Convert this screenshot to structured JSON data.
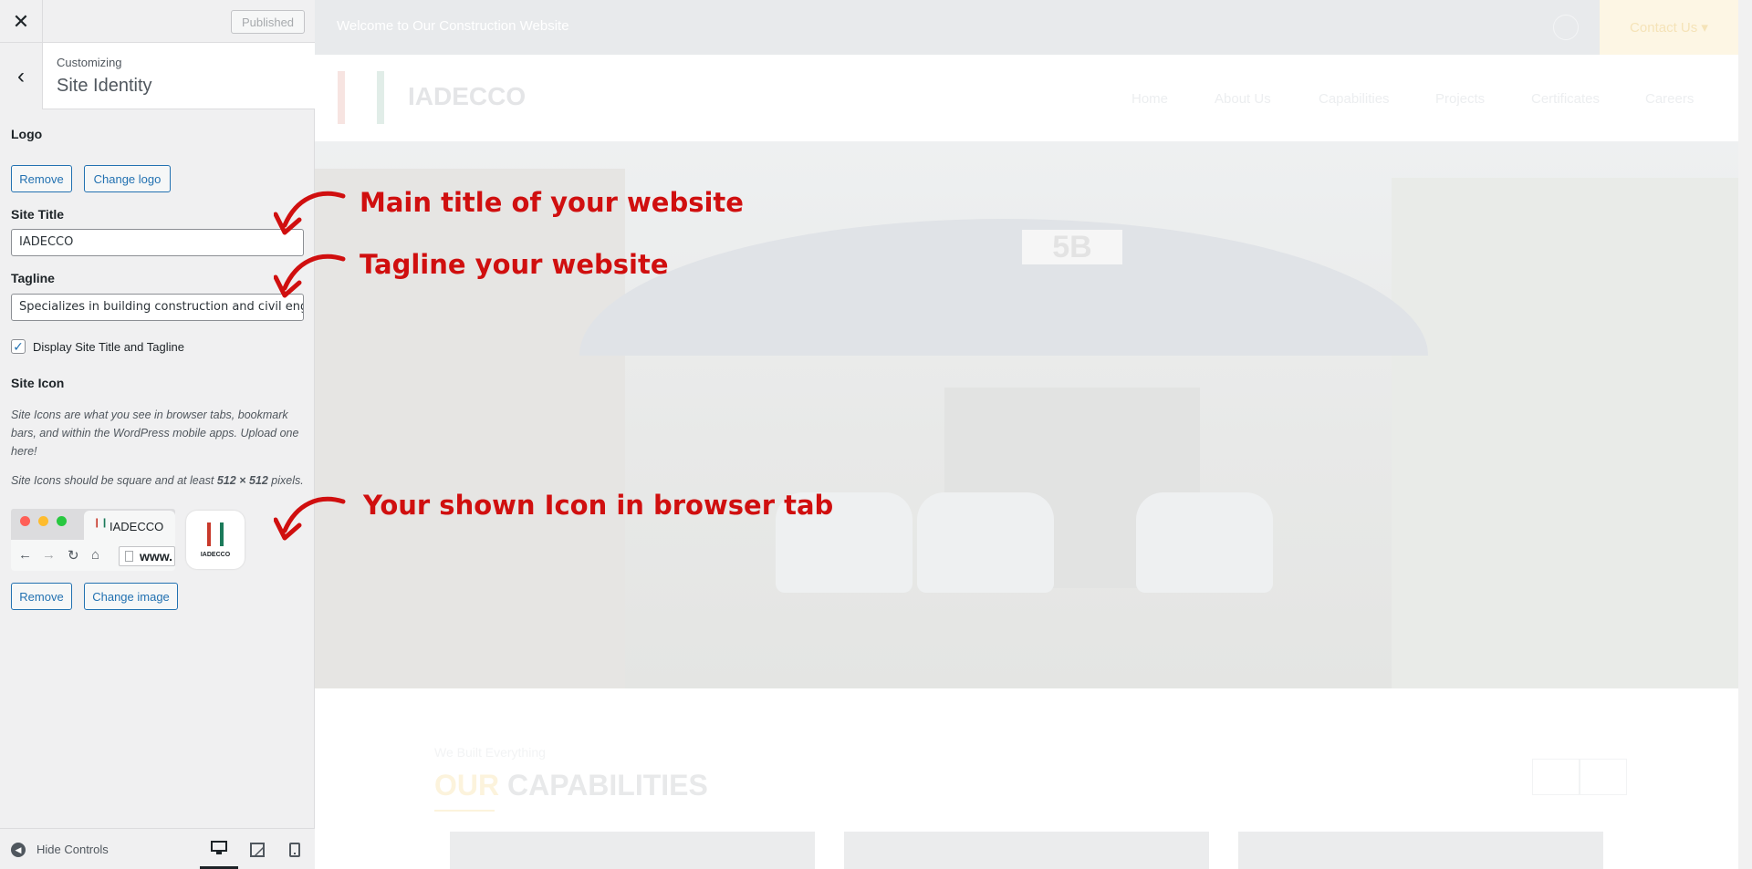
{
  "panel": {
    "published_label": "Published",
    "customizing_label": "Customizing",
    "section_title": "Site Identity",
    "logo": {
      "label": "Logo",
      "remove_label": "Remove",
      "change_label": "Change logo"
    },
    "site_title": {
      "label": "Site Title",
      "value": "IADECCO"
    },
    "tagline": {
      "label": "Tagline",
      "value": "Specializes in building construction and civil engi"
    },
    "display_checkbox": {
      "label": "Display Site Title and Tagline",
      "checked": true
    },
    "site_icon": {
      "label": "Site Icon",
      "description": "Site Icons are what you see in browser tabs, bookmark bars, and within the WordPress mobile apps. Upload one here!",
      "requirement_prefix": "Site Icons should be square and at least ",
      "requirement_size": "512 × 512",
      "requirement_suffix": " pixels.",
      "tab_title": "IADECCO",
      "url_text": "www.",
      "icon_caption": "IADECCO",
      "remove_label": "Remove",
      "change_label": "Change image"
    },
    "footer": {
      "hide_controls_label": "Hide Controls"
    }
  },
  "preview": {
    "topbar_text": "Welcome to Our Construction Website",
    "contact_label": "Contact Us",
    "contact_chevron": "▾",
    "brand": "IADECCO",
    "nav": [
      "Home",
      "About Us",
      "Capabilities",
      "Projects",
      "Certificates",
      "Careers"
    ],
    "hero_sign": "5B",
    "section_subtitle": "We Built Everything",
    "section_heading_accent": "OUR",
    "section_heading_rest": " CAPABILITIES"
  },
  "annotations": {
    "title_note": "Main title of your website",
    "tagline_note": "Tagline your website",
    "icon_note": "Your shown Icon in browser tab"
  },
  "colors": {
    "annotation": "#d00f0f",
    "wp_blue": "#2271b1",
    "logo_red": "#c8392b",
    "logo_green": "#1b7a5a"
  }
}
